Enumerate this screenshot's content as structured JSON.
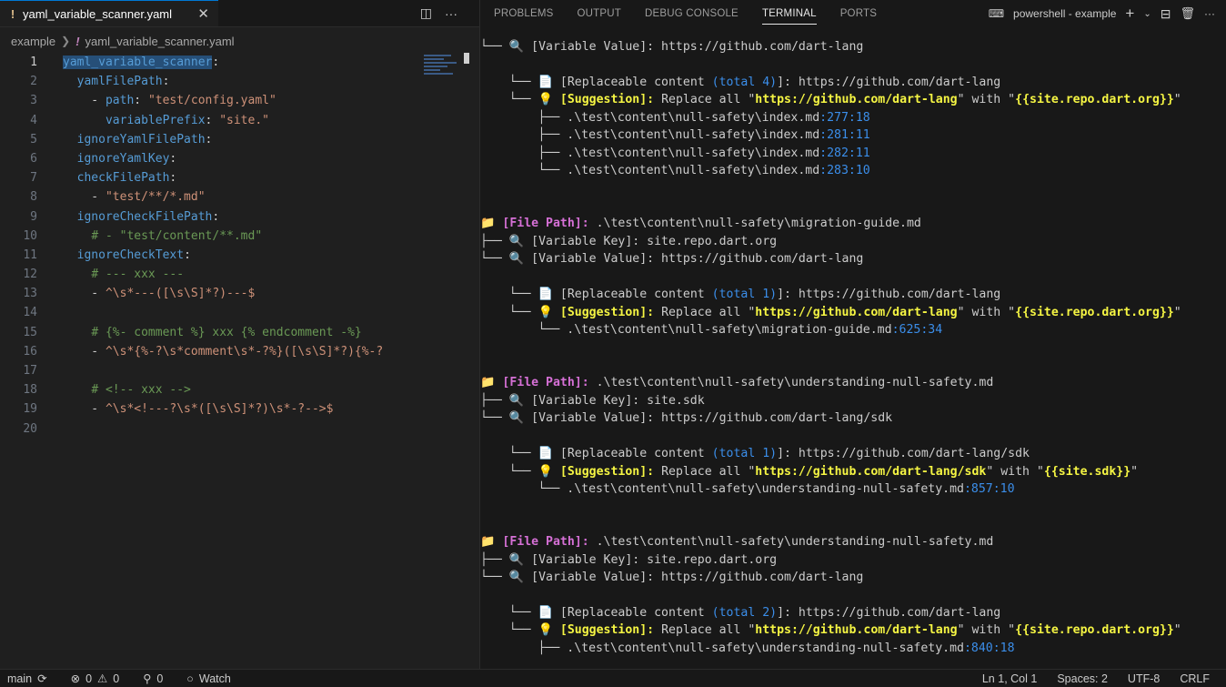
{
  "editor": {
    "tab_label": "yaml_variable_scanner.yaml",
    "breadcrumb_folder": "example",
    "breadcrumb_file": "yaml_variable_scanner.yaml",
    "lines": [
      [
        [
          "k",
          "yaml_variable_scanner",
          "sel"
        ],
        [
          "p",
          ":"
        ]
      ],
      [
        [
          "p",
          "  "
        ],
        [
          "k",
          "yamlFilePath"
        ],
        [
          "p",
          ":"
        ]
      ],
      [
        [
          "p",
          "    - "
        ],
        [
          "k",
          "path"
        ],
        [
          "p",
          ": "
        ],
        [
          "s",
          "\"test/config.yaml\""
        ]
      ],
      [
        [
          "p",
          "      "
        ],
        [
          "k",
          "variablePrefix"
        ],
        [
          "p",
          ": "
        ],
        [
          "s",
          "\"site.\""
        ]
      ],
      [
        [
          "p",
          "  "
        ],
        [
          "k",
          "ignoreYamlFilePath"
        ],
        [
          "p",
          ":"
        ]
      ],
      [
        [
          "p",
          "  "
        ],
        [
          "k",
          "ignoreYamlKey"
        ],
        [
          "p",
          ":"
        ]
      ],
      [
        [
          "p",
          "  "
        ],
        [
          "k",
          "checkFilePath"
        ],
        [
          "p",
          ":"
        ]
      ],
      [
        [
          "p",
          "    - "
        ],
        [
          "s",
          "\"test/**/*.md\""
        ]
      ],
      [
        [
          "p",
          "  "
        ],
        [
          "k",
          "ignoreCheckFilePath"
        ],
        [
          "p",
          ":"
        ]
      ],
      [
        [
          "p",
          "    "
        ],
        [
          "c",
          "# - \"test/content/**.md\""
        ]
      ],
      [
        [
          "p",
          "  "
        ],
        [
          "k",
          "ignoreCheckText"
        ],
        [
          "p",
          ":"
        ]
      ],
      [
        [
          "p",
          "    "
        ],
        [
          "c",
          "# --- xxx ---"
        ]
      ],
      [
        [
          "p",
          "    - "
        ],
        [
          "s",
          "^\\s*---([\\s\\S]*?)---$"
        ]
      ],
      [
        [
          "p",
          ""
        ]
      ],
      [
        [
          "p",
          "    "
        ],
        [
          "c",
          "# {%- comment %} xxx {% endcomment -%}"
        ]
      ],
      [
        [
          "p",
          "    - "
        ],
        [
          "s",
          "^\\s*{%-?\\s*comment\\s*-?%}([\\s\\S]*?){%-?"
        ]
      ],
      [
        [
          "p",
          ""
        ]
      ],
      [
        [
          "p",
          "    "
        ],
        [
          "c",
          "# <!-- xxx -->"
        ]
      ],
      [
        [
          "p",
          "    - "
        ],
        [
          "s",
          "^\\s*<!---?\\s*([\\s\\S]*?)\\s*-?-->$"
        ]
      ],
      [
        [
          "p",
          ""
        ]
      ]
    ]
  },
  "panel": {
    "tabs": [
      "PROBLEMS",
      "OUTPUT",
      "DEBUG CONSOLE",
      "TERMINAL",
      "PORTS"
    ],
    "active_tab": "TERMINAL",
    "terminal_name": "powershell - example"
  },
  "terminal": {
    "lines": [
      [
        [
          "tree",
          "└── "
        ],
        [
          "mag",
          "🔍 "
        ],
        [
          "p",
          "[Variable Value]: https://github.com/dart-lang"
        ]
      ],
      [
        [
          "p",
          " "
        ]
      ],
      [
        [
          "tree",
          "    └── "
        ],
        [
          "doc",
          "📄 "
        ],
        [
          "p",
          "[Replaceable content "
        ],
        [
          "blu",
          "(total 4)"
        ],
        [
          "p",
          "]: https://github.com/dart-lang"
        ]
      ],
      [
        [
          "tree",
          "    └── "
        ],
        [
          "bulb",
          "💡 "
        ],
        [
          "yel",
          "[Suggestion]:"
        ],
        [
          "p",
          " Replace all \""
        ],
        [
          "yel",
          "https://github.com/dart-lang"
        ],
        [
          "p",
          "\" with \""
        ],
        [
          "yel",
          "{{site.repo.dart.org}}"
        ],
        [
          "p",
          "\""
        ]
      ],
      [
        [
          "tree",
          "        ├── "
        ],
        [
          "p",
          ".\\test\\content\\null-safety\\index.md"
        ],
        [
          "num",
          ":277:18"
        ]
      ],
      [
        [
          "tree",
          "        ├── "
        ],
        [
          "p",
          ".\\test\\content\\null-safety\\index.md"
        ],
        [
          "num",
          ":281:11"
        ]
      ],
      [
        [
          "tree",
          "        ├── "
        ],
        [
          "p",
          ".\\test\\content\\null-safety\\index.md"
        ],
        [
          "num",
          ":282:11"
        ]
      ],
      [
        [
          "tree",
          "        └── "
        ],
        [
          "p",
          ".\\test\\content\\null-safety\\index.md"
        ],
        [
          "num",
          ":283:10"
        ]
      ],
      [
        [
          "p",
          " "
        ]
      ],
      [
        [
          "p",
          " "
        ]
      ],
      [
        [
          "fold",
          "📁 "
        ],
        [
          "mag2",
          "[File Path]:"
        ],
        [
          "p",
          " .\\test\\content\\null-safety\\migration-guide.md"
        ]
      ],
      [
        [
          "tree",
          "├── "
        ],
        [
          "mag",
          "🔍 "
        ],
        [
          "p",
          "[Variable Key]: site.repo.dart.org"
        ]
      ],
      [
        [
          "tree",
          "└── "
        ],
        [
          "mag",
          "🔍 "
        ],
        [
          "p",
          "[Variable Value]: https://github.com/dart-lang"
        ]
      ],
      [
        [
          "p",
          " "
        ]
      ],
      [
        [
          "tree",
          "    └── "
        ],
        [
          "doc",
          "📄 "
        ],
        [
          "p",
          "[Replaceable content "
        ],
        [
          "blu",
          "(total 1)"
        ],
        [
          "p",
          "]: https://github.com/dart-lang"
        ]
      ],
      [
        [
          "tree",
          "    └── "
        ],
        [
          "bulb",
          "💡 "
        ],
        [
          "yel",
          "[Suggestion]:"
        ],
        [
          "p",
          " Replace all \""
        ],
        [
          "yel",
          "https://github.com/dart-lang"
        ],
        [
          "p",
          "\" with \""
        ],
        [
          "yel",
          "{{site.repo.dart.org}}"
        ],
        [
          "p",
          "\""
        ]
      ],
      [
        [
          "tree",
          "        └── "
        ],
        [
          "p",
          ".\\test\\content\\null-safety\\migration-guide.md"
        ],
        [
          "num",
          ":625:34"
        ]
      ],
      [
        [
          "p",
          " "
        ]
      ],
      [
        [
          "p",
          " "
        ]
      ],
      [
        [
          "fold",
          "📁 "
        ],
        [
          "mag2",
          "[File Path]:"
        ],
        [
          "p",
          " .\\test\\content\\null-safety\\understanding-null-safety.md"
        ]
      ],
      [
        [
          "tree",
          "├── "
        ],
        [
          "mag",
          "🔍 "
        ],
        [
          "p",
          "[Variable Key]: site.sdk"
        ]
      ],
      [
        [
          "tree",
          "└── "
        ],
        [
          "mag",
          "🔍 "
        ],
        [
          "p",
          "[Variable Value]: https://github.com/dart-lang/sdk"
        ]
      ],
      [
        [
          "p",
          " "
        ]
      ],
      [
        [
          "tree",
          "    └── "
        ],
        [
          "doc",
          "📄 "
        ],
        [
          "p",
          "[Replaceable content "
        ],
        [
          "blu",
          "(total 1)"
        ],
        [
          "p",
          "]: https://github.com/dart-lang/sdk"
        ]
      ],
      [
        [
          "tree",
          "    └── "
        ],
        [
          "bulb",
          "💡 "
        ],
        [
          "yel",
          "[Suggestion]:"
        ],
        [
          "p",
          " Replace all \""
        ],
        [
          "yel",
          "https://github.com/dart-lang/sdk"
        ],
        [
          "p",
          "\" with \""
        ],
        [
          "yel",
          "{{site.sdk}}"
        ],
        [
          "p",
          "\""
        ]
      ],
      [
        [
          "tree",
          "        └── "
        ],
        [
          "p",
          ".\\test\\content\\null-safety\\understanding-null-safety.md"
        ],
        [
          "num",
          ":857:10"
        ]
      ],
      [
        [
          "p",
          " "
        ]
      ],
      [
        [
          "p",
          " "
        ]
      ],
      [
        [
          "fold",
          "📁 "
        ],
        [
          "mag2",
          "[File Path]:"
        ],
        [
          "p",
          " .\\test\\content\\null-safety\\understanding-null-safety.md"
        ]
      ],
      [
        [
          "tree",
          "├── "
        ],
        [
          "mag",
          "🔍 "
        ],
        [
          "p",
          "[Variable Key]: site.repo.dart.org"
        ]
      ],
      [
        [
          "tree",
          "└── "
        ],
        [
          "mag",
          "🔍 "
        ],
        [
          "p",
          "[Variable Value]: https://github.com/dart-lang"
        ]
      ],
      [
        [
          "p",
          " "
        ]
      ],
      [
        [
          "tree",
          "    └── "
        ],
        [
          "doc",
          "📄 "
        ],
        [
          "p",
          "[Replaceable content "
        ],
        [
          "blu",
          "(total 2)"
        ],
        [
          "p",
          "]: https://github.com/dart-lang"
        ]
      ],
      [
        [
          "tree",
          "    └── "
        ],
        [
          "bulb",
          "💡 "
        ],
        [
          "yel",
          "[Suggestion]:"
        ],
        [
          "p",
          " Replace all \""
        ],
        [
          "yel",
          "https://github.com/dart-lang"
        ],
        [
          "p",
          "\" with \""
        ],
        [
          "yel",
          "{{site.repo.dart.org}}"
        ],
        [
          "p",
          "\""
        ]
      ],
      [
        [
          "tree",
          "        ├── "
        ],
        [
          "p",
          ".\\test\\content\\null-safety\\understanding-null-safety.md"
        ],
        [
          "num",
          ":840:18"
        ]
      ]
    ]
  },
  "status": {
    "branch": "main",
    "errors": "0",
    "warnings": "0",
    "ports": "0",
    "watch": "Watch",
    "position": "Ln 1, Col 1",
    "spaces": "Spaces: 2",
    "encoding": "UTF-8",
    "eol": "CRLF"
  }
}
